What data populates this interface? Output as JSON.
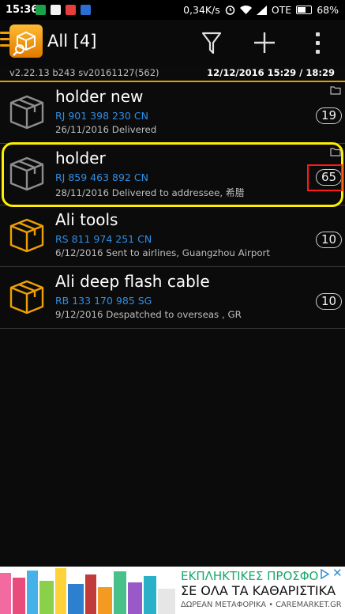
{
  "status_bar": {
    "time": "15:36",
    "network_speed": "0,34K/s",
    "carrier": "OTE",
    "battery": "68%"
  },
  "app_bar": {
    "title": "All [4]",
    "accent_color": "#f0a000"
  },
  "version_row": {
    "version": "v2.22.13 b243 sv20161127(562)",
    "last_update": "12/12/2016 15:29 / 18:29"
  },
  "packages": [
    {
      "title": "holder new",
      "tracking": "RJ 901 398 230 CN",
      "status": "26/11/2016 Delivered",
      "count": "19",
      "icon": "box-icon-delivered",
      "icon_color": "#8e8e8e"
    },
    {
      "title": "holder",
      "tracking": "RJ 859 463 892 CN",
      "status": "28/11/2016 Delivered to addressee, 希腊",
      "count": "65",
      "icon": "box-icon-delivered",
      "icon_color": "#8e8e8e"
    },
    {
      "title": "Ali tools",
      "tracking": "RS 811 974 251 CN",
      "status": "6/12/2016 Sent to airlines, Guangzhou Airport",
      "count": "10",
      "icon": "box-icon-in-transit",
      "icon_color": "#f0a000"
    },
    {
      "title": "Ali deep flash cable",
      "tracking": "RB 133 170 985 SG",
      "status": "9/12/2016 Despatched to overseas , GR",
      "count": "10",
      "icon": "box-icon-in-transit",
      "icon_color": "#f0a000"
    }
  ],
  "ad": {
    "line1": "ΕΚΠΛΗΚΤΙΚΕΣ ΠΡΟΣΦΟ",
    "line2": "ΣΕ ΟΛΑ ΤΑ ΚΑΘΑΡΙΣΤΙΚΑ",
    "line3": "ΔΩΡΕΑΝ ΜΕΤΑΦΟΡΙΚΑ • CAREMARKET.GR"
  }
}
